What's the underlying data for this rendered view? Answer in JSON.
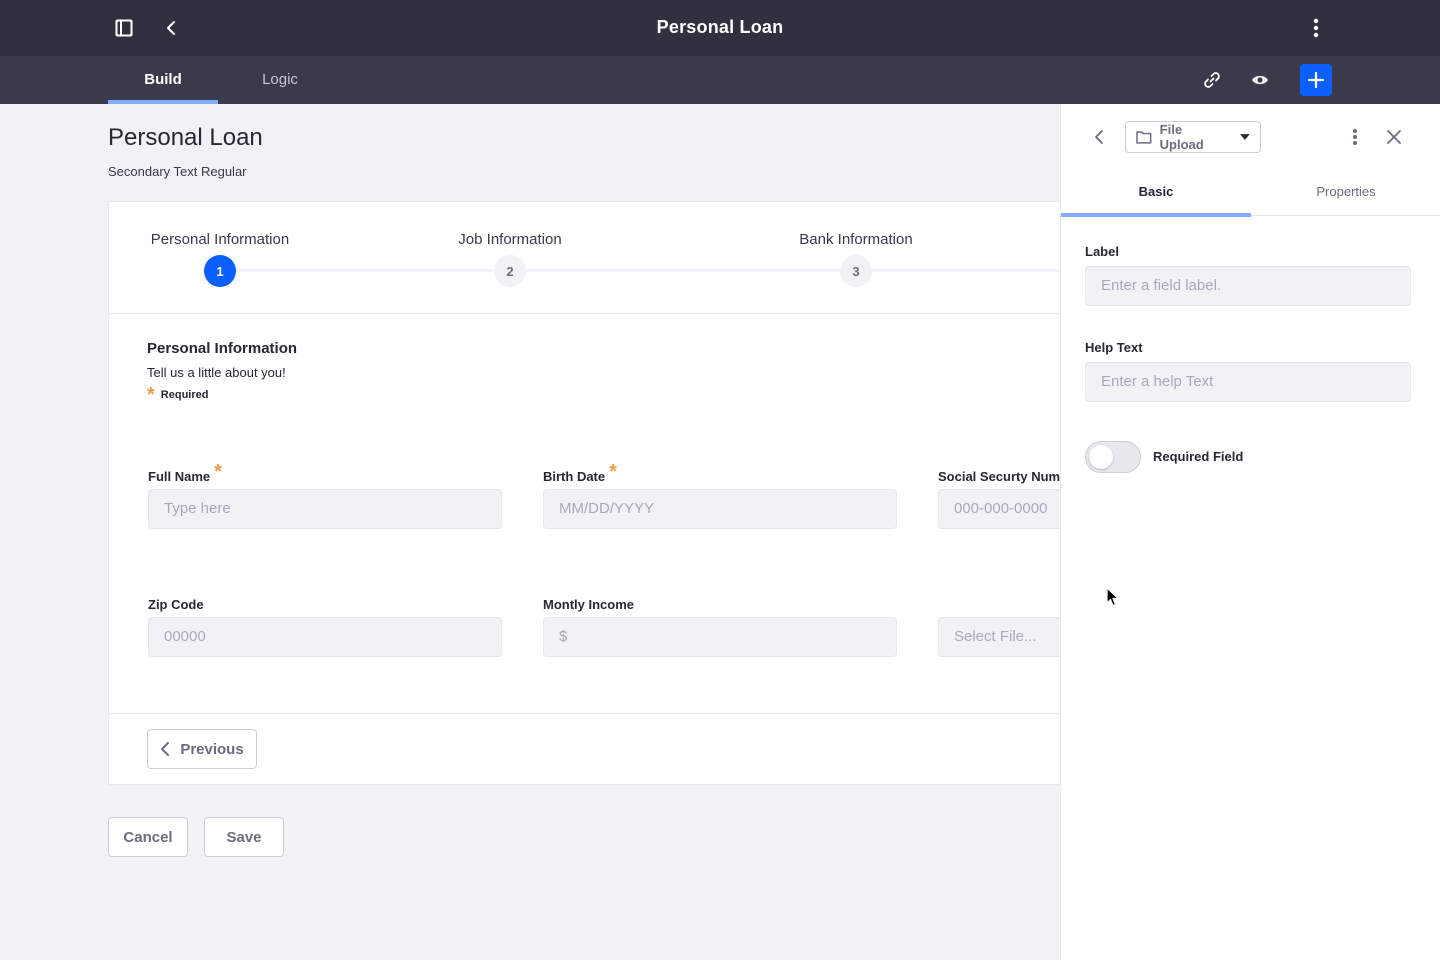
{
  "app": {
    "title": "Personal Loan"
  },
  "tabs": [
    {
      "label": "Build",
      "active": true
    },
    {
      "label": "Logic",
      "active": false
    }
  ],
  "icons": {
    "sidebar": "sidebar-toggle-icon",
    "back": "chevron-left-icon",
    "more": "kebab-menu-icon",
    "link": "link-icon",
    "preview": "eye-icon",
    "add": "plus-icon"
  },
  "colors": {
    "topbar": "#30313f",
    "tabbar": "#393a4a",
    "accent": "#0b5fff",
    "tab_indicator": "#80acff",
    "required": "#f09d4a"
  },
  "form": {
    "title": "Personal Loan",
    "subtitle": "Secondary Text Regular",
    "steps": [
      {
        "label": "Personal Information",
        "number": "1",
        "active": true
      },
      {
        "label": "Job Information",
        "number": "2",
        "active": false
      },
      {
        "label": "Bank Information",
        "number": "3",
        "active": false
      }
    ],
    "section": {
      "title": "Personal Information",
      "description": "Tell us a little about you!",
      "required_note": "Required",
      "asterisk": "*"
    },
    "fields": [
      {
        "label": "Full Name",
        "placeholder": "Type here",
        "required": true
      },
      {
        "label": "Birth Date",
        "placeholder": "MM/DD/YYYY",
        "required": true
      },
      {
        "label": "Social Securty Num",
        "placeholder": "000-000-0000",
        "required": false
      },
      {
        "label": "Zip Code",
        "placeholder": "00000",
        "required": false
      },
      {
        "label": "Montly Income",
        "placeholder": "$",
        "required": false
      },
      {
        "label": "",
        "placeholder": "Select File...",
        "required": false
      }
    ],
    "previous_label": "Previous"
  },
  "actions": {
    "cancel_label": "Cancel",
    "save_label": "Save"
  },
  "sidepanel": {
    "field_type": "File Upload",
    "tabs": [
      {
        "label": "Basic",
        "active": true
      },
      {
        "label": "Properties",
        "active": false
      }
    ],
    "label_title": "Label",
    "label_placeholder": "Enter a field label.",
    "help_title": "Help Text",
    "help_placeholder": "Enter a help Text",
    "required_toggle_label": "Required Field",
    "required_toggle_on": false
  }
}
